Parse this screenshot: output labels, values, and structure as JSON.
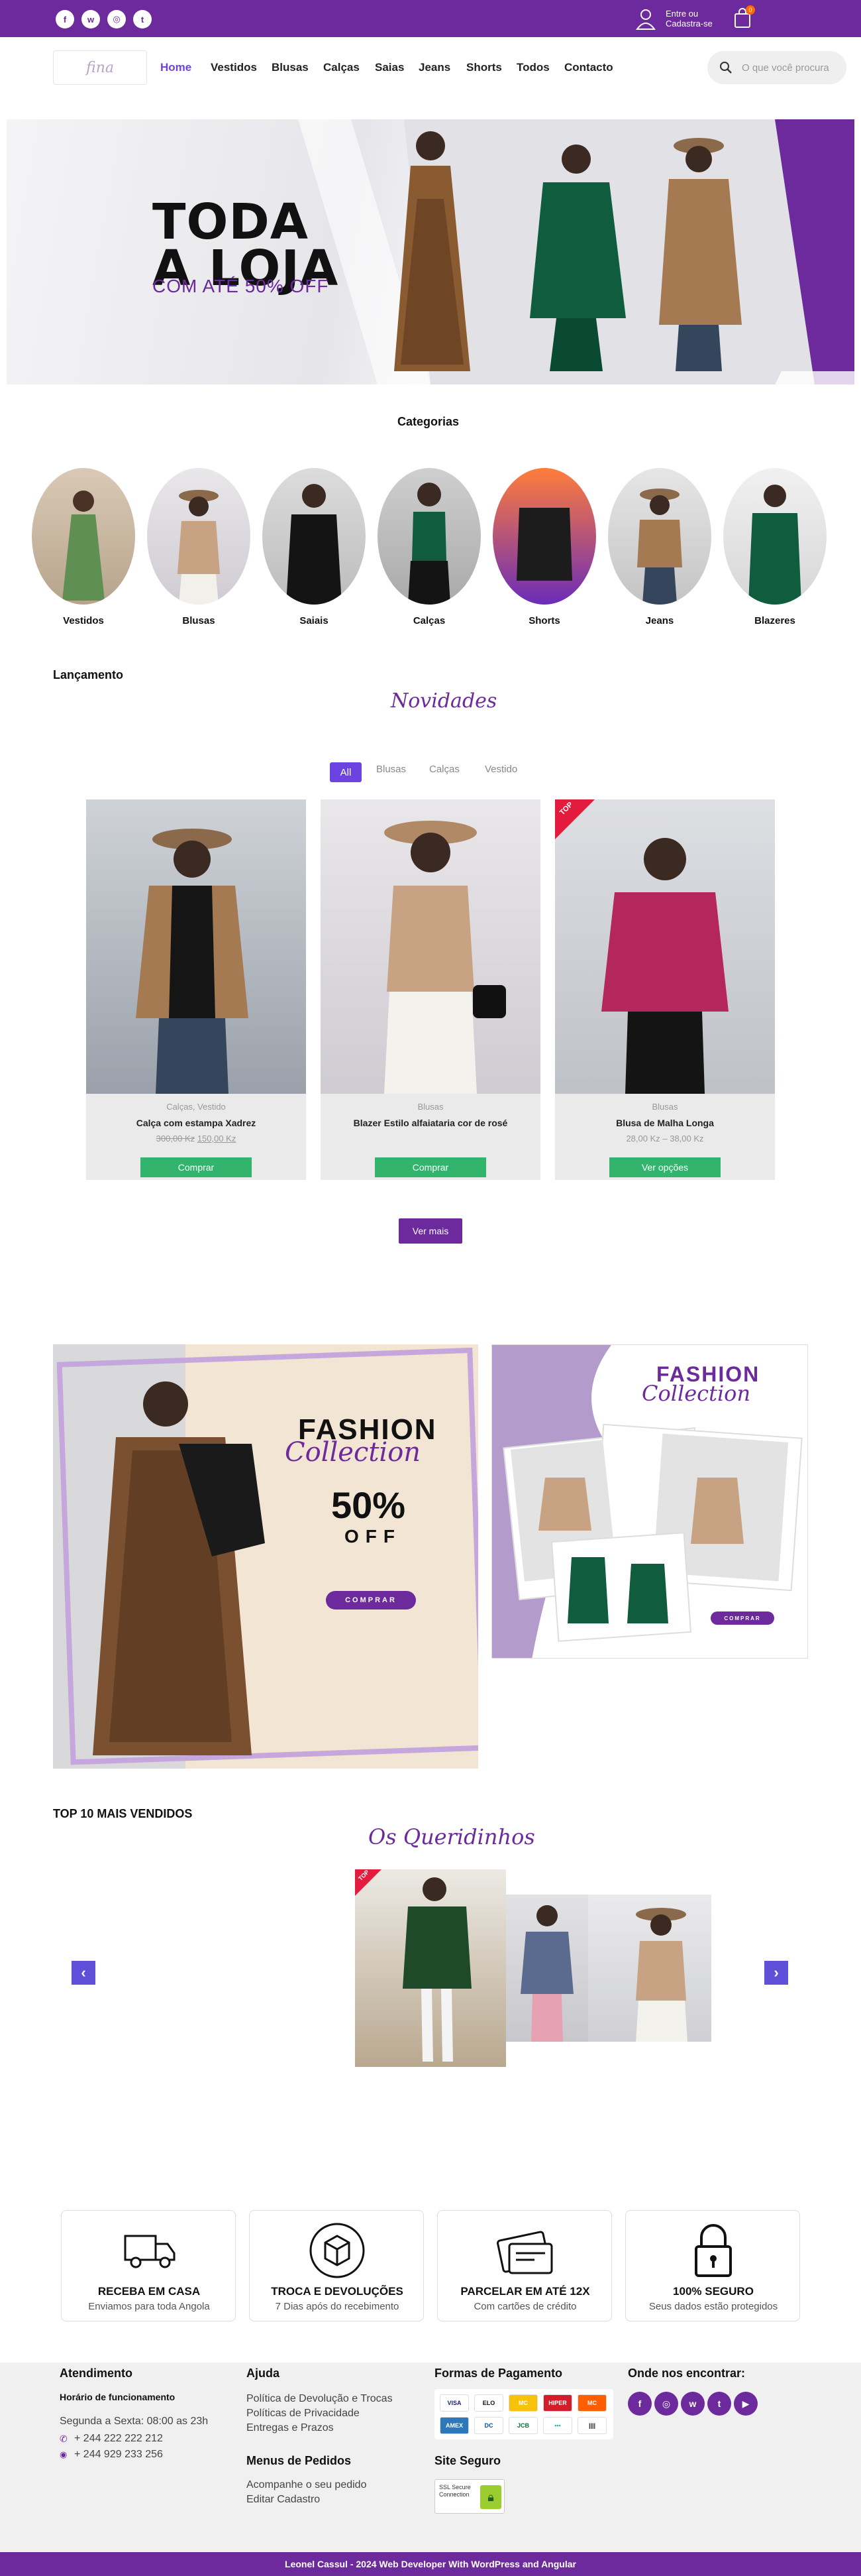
{
  "colors": {
    "brand": "#6c2a9c",
    "accent": "#6c43e0",
    "button_green": "#32b46c",
    "arrow": "#5f4fd9"
  },
  "topbar": {
    "social_icons": [
      "facebook-icon",
      "whatsapp-icon",
      "instagram-icon",
      "twitter-icon"
    ],
    "social_glyphs": [
      "f",
      "w",
      "◎",
      "t"
    ],
    "account_line1": "Entre ou",
    "account_line2": "Cadastra-se",
    "cart_count": "0"
  },
  "header": {
    "logo_text": "fina",
    "nav": [
      "Home",
      "Vestidos",
      "Blusas",
      "Calças",
      "Saias",
      "Jeans",
      "Shorts",
      "Todos",
      "Contacto"
    ],
    "search_placeholder": "O que você procura"
  },
  "hero": {
    "title_line1": "TODA",
    "title_line2": "A LOJA",
    "subtitle": "COM ATÉ 50% OFF"
  },
  "categories": {
    "title": "Categorias",
    "items": [
      "Vestidos",
      "Blusas",
      "Saiais",
      "Calças",
      "Shorts",
      "Jeans",
      "Blazeres"
    ]
  },
  "launch": {
    "title": "Lançamento",
    "script": "Novidades",
    "filters": [
      "All",
      "Blusas",
      "Calças",
      "Vestido"
    ],
    "products": [
      {
        "category": "Calças, Vestido",
        "name": "Calça com estampa Xadrez",
        "old_price": "300,00 Kz",
        "price": "150,00 Kz",
        "button": "Comprar"
      },
      {
        "category": "Blusas",
        "name": "Blazer Estilo alfaiataria cor de rosé",
        "old_price": "",
        "price": "",
        "button": "Comprar"
      },
      {
        "category": "Blusas",
        "name": "Blusa de Malha Longa",
        "old_price": "",
        "price": "28,00 Kz – 38,00 Kz",
        "button": "Ver opções",
        "badge": "TOP"
      }
    ],
    "more_button": "Ver mais"
  },
  "banners": {
    "b1_fashion": "FASHION",
    "b1_collection": "Collection",
    "b1_percent": "50%",
    "b1_off": "OFF",
    "b1_button": "COMPRAR",
    "b2_fashion": "FASHION",
    "b2_collection": "Collection",
    "b2_button": "COMPRAR"
  },
  "top10": {
    "title": "TOP 10 MAIS VENDIDOS",
    "script": "Os Queridinhos",
    "badge": "TOP"
  },
  "features": [
    {
      "title": "RECEBA EM CASA",
      "subtitle": "Enviamos para toda Angola",
      "icon": "truck-icon"
    },
    {
      "title": "TROCA E DEVOLUÇÕES",
      "subtitle": "7 Dias após do recebimento",
      "icon": "box-return-icon"
    },
    {
      "title": "PARCELAR EM ATÉ 12X",
      "subtitle": "Com cartões de crédito",
      "icon": "credit-card-icon"
    },
    {
      "title": "100% SEGURO",
      "subtitle": "Seus dados estão protegidos",
      "icon": "lock-icon"
    }
  ],
  "footer": {
    "atendimento_title": "Atendimento",
    "hours_title": "Horário de funcionamento",
    "hours": "Segunda a Sexta: 08:00 as 23h",
    "phone": "+ 244 222 222 212",
    "whatsapp": "+ 244 929 233 256",
    "ajuda_title": "Ajuda",
    "ajuda_links": [
      "Política de Devolução e Trocas",
      "Políticas de Privacidade",
      "Entregas e Prazos"
    ],
    "menus_title": "Menus de Pedidos",
    "menus_links": [
      "Acompanhe o seu pedido",
      "Editar Cadastro"
    ],
    "payment_title": "Formas de Pagamento",
    "payment_methods": [
      "VISA",
      "ELO",
      "MC",
      "HIPER",
      "MC",
      "AMEX",
      "DC",
      "JCB",
      "•••",
      "||||"
    ],
    "secure_title": "Site Seguro",
    "ssl_text": "SSL Secure Connection",
    "find_title": "Onde nos encontrar:",
    "find_glyphs": [
      "f",
      "◎",
      "w",
      "t",
      "▶"
    ],
    "credit": "Leonel Cassul - 2024 Web Developer With WordPress and Angular"
  }
}
